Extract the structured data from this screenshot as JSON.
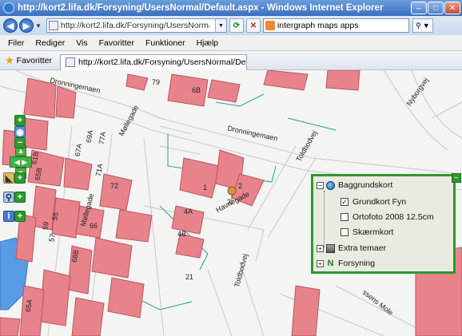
{
  "window": {
    "title": "http://kort2.lifa.dk/Forsyning/UsersNormal/Default.aspx - Windows Internet Explorer",
    "min": "–",
    "max": "□",
    "close": "✕"
  },
  "address": {
    "url": "http://kort2.lifa.dk/Forsyning/UsersNormal/Default.aspx",
    "search_value": "intergraph maps apps",
    "back": "◀",
    "forward": "▶"
  },
  "menu": {
    "items": [
      "Filer",
      "Rediger",
      "Vis",
      "Favoritter",
      "Funktioner",
      "Hjælp"
    ]
  },
  "favorites_bar": {
    "favorites_label": "Favoritter",
    "tab_title": "http://kort2.lifa.dk/Forsyning/UsersNormal/Default.aspx"
  },
  "map": {
    "street_labels": [
      "Dronningemaen",
      "Dronningemaen",
      "Møllegade",
      "Møllegade",
      "Havnegade",
      "Toldbodvej",
      "Toldbodvej",
      "Nyborgvej",
      "ssens Mole"
    ],
    "house_numbers": [
      "79",
      "77A",
      "61B",
      "65B",
      "67A",
      "69A",
      "71A",
      "72",
      "57",
      "59",
      "55",
      "66",
      "6B",
      "3",
      "2",
      "1",
      "4A",
      "4B",
      "21",
      "68B",
      "65A"
    ]
  },
  "layer_panel": {
    "items": [
      {
        "label": "Baggrundskort",
        "toggle": "−",
        "icon": "globe-icon"
      },
      {
        "label": "Grundkort Fyn",
        "checked": true
      },
      {
        "label": "Ortofoto 2008 12.5cm",
        "checked": false
      },
      {
        "label": "Skærmkort",
        "checked": false
      },
      {
        "label": "Extra temaer",
        "toggle": "+",
        "icon": "theme-icon"
      },
      {
        "label": "Forsyning",
        "toggle": "+",
        "icon": "forsyning-icon"
      }
    ],
    "check_mark": "✓"
  },
  "colors": {
    "building": "#e8838c",
    "building_stroke": "#b85560",
    "water": "#5a9be6",
    "control_green": "#2c9a2c",
    "panel_border": "#2d9a2d"
  }
}
